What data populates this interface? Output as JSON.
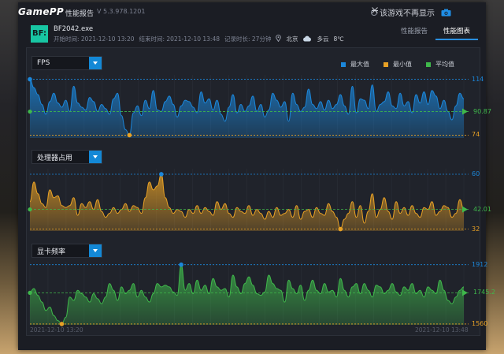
{
  "app": {
    "logo": "GamePP",
    "title": "性能报告",
    "version": "V 5.3.978.1201",
    "no_show_label": "该游戏不再显示"
  },
  "icons": {
    "camera": "camera-icon",
    "minimize": "minimize-icon",
    "close": "close-icon",
    "weather": "cloud-icon",
    "location": "location-pin-icon"
  },
  "info": {
    "icon_text": "BF:",
    "game": "BF2042.exe",
    "start": "开始时间: 2021-12-10 13:20",
    "end": "结束时间: 2021-12-10 13:48",
    "duration": "记录时长: 27分钟",
    "city": "北京",
    "weather": "多云",
    "temp": "8℃"
  },
  "tabs": [
    {
      "label": "性能报告",
      "active": false
    },
    {
      "label": "性能图表",
      "active": true
    }
  ],
  "legend": [
    {
      "label": "最大值",
      "color": "#1b87db"
    },
    {
      "label": "最小值",
      "color": "#e8a125"
    },
    {
      "label": "平均值",
      "color": "#3fb84b"
    }
  ],
  "x_axis": {
    "start": "2021-12-10 13:20",
    "end": "2021-12-10 13:48"
  },
  "chart_data": [
    {
      "type": "area",
      "title": "FPS",
      "color": "#1b87db",
      "max": 114,
      "min": 74,
      "avg": "90.87",
      "avg_value": 90.87,
      "ylim": [
        72,
        116
      ],
      "values": [
        114,
        108,
        103,
        96,
        89,
        98,
        104,
        97,
        94,
        99,
        91,
        109,
        97,
        94,
        92,
        101,
        98,
        91,
        96,
        93,
        89,
        100,
        104,
        88,
        78,
        74,
        90,
        95,
        88,
        99,
        93,
        106,
        92,
        91,
        98,
        102,
        96,
        87,
        95,
        99,
        98,
        94,
        90,
        105,
        97,
        100,
        92,
        99,
        89,
        84,
        94,
        103,
        90,
        96,
        91,
        95,
        102,
        91,
        96,
        87,
        92,
        104,
        99,
        94,
        98,
        84,
        104,
        96,
        91,
        94,
        107,
        96,
        93,
        98,
        92,
        99,
        93,
        96,
        103,
        95,
        89,
        109,
        90,
        100,
        99,
        93,
        110,
        91,
        96,
        98,
        105,
        95,
        93,
        104,
        95,
        98,
        90,
        103,
        97,
        105,
        96,
        106,
        102,
        93,
        99,
        91,
        85,
        95,
        104,
        100
      ]
    },
    {
      "type": "area",
      "title": "处理器占用",
      "color": "#e8a125",
      "max": 60,
      "min": 32,
      "avg": "42.01",
      "avg_value": 42.01,
      "ylim": [
        31,
        62
      ],
      "values": [
        46,
        56,
        50,
        45,
        43,
        52,
        48,
        49,
        44,
        43,
        44,
        48,
        39,
        45,
        43,
        46,
        42,
        47,
        41,
        38,
        40,
        43,
        40,
        42,
        45,
        41,
        44,
        43,
        40,
        48,
        56,
        52,
        54,
        60,
        48,
        43,
        40,
        42,
        41,
        38,
        42,
        40,
        44,
        40,
        43,
        41,
        39,
        46,
        42,
        45,
        40,
        38,
        43,
        41,
        40,
        44,
        39,
        42,
        40,
        37,
        41,
        38,
        43,
        39,
        40,
        42,
        38,
        44,
        37,
        41,
        42,
        38,
        43,
        40,
        39,
        45,
        41,
        38,
        32,
        37,
        40,
        46,
        38,
        44,
        35,
        41,
        50,
        38,
        42,
        48,
        41,
        37,
        46,
        40,
        43,
        39,
        44,
        40,
        38,
        43,
        42,
        46,
        39,
        41,
        44,
        43,
        38,
        40,
        47,
        42
      ]
    },
    {
      "type": "area",
      "title": "显卡频率",
      "color": "#3fb84b",
      "max": 1912,
      "min": 1560,
      "avg": "1745.2",
      "avg_value": 1745.2,
      "ylim": [
        1555,
        1920
      ],
      "values": [
        1750,
        1770,
        1730,
        1690,
        1640,
        1660,
        1610,
        1580,
        1560,
        1600,
        1720,
        1700,
        1760,
        1740,
        1720,
        1690,
        1740,
        1710,
        1680,
        1720,
        1800,
        1760,
        1700,
        1780,
        1740,
        1760,
        1800,
        1720,
        1760,
        1720,
        1690,
        1740,
        1800,
        1780,
        1790,
        1780,
        1750,
        1730,
        1912,
        1760,
        1800,
        1740,
        1820,
        1760,
        1790,
        1740,
        1830,
        1780,
        1760,
        1770,
        1720,
        1850,
        1780,
        1740,
        1800,
        1840,
        1790,
        1740,
        1730,
        1750,
        1850,
        1800,
        1770,
        1760,
        1690,
        1820,
        1770,
        1740,
        1790,
        1700,
        1760,
        1820,
        1760,
        1740,
        1800,
        1750,
        1760,
        1720,
        1830,
        1760,
        1720,
        1780,
        1800,
        1740,
        1800,
        1760,
        1720,
        1790,
        1780,
        1740,
        1760,
        1800,
        1750,
        1730,
        1780,
        1760,
        1800,
        1740,
        1760,
        1720,
        1780,
        1760,
        1740,
        1820,
        1760,
        1700,
        1680,
        1720,
        1760,
        1780
      ]
    }
  ]
}
